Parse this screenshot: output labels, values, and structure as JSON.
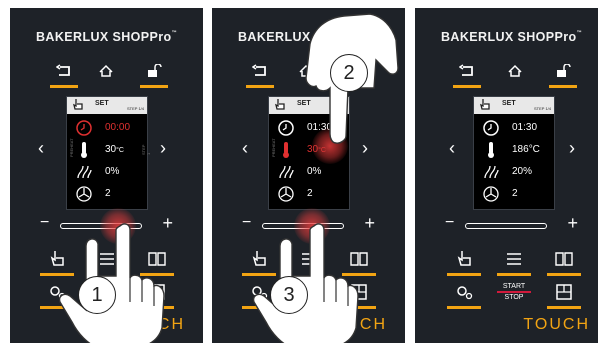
{
  "brand": {
    "name": "BAKERLUX SHOP",
    "script": "Pro",
    "tm": "™"
  },
  "screen": {
    "header_label": "SET",
    "step_label": "STEP 1/4",
    "left_label": "PREHEAT",
    "right_label": "STEP 1"
  },
  "panels": [
    {
      "time": "00:00",
      "temperature": "30",
      "temp_unit": "°C",
      "humidity": "0%",
      "fan": "2",
      "step_number": "1"
    },
    {
      "time": "01:30",
      "temperature": "30",
      "temp_unit": "°C",
      "humidity": "0%",
      "fan": "2",
      "step_number": "3",
      "step_number_top": "2"
    },
    {
      "time": "01:30",
      "temperature": "186",
      "temp_unit": "°C",
      "humidity": "20%",
      "fan": "2",
      "start_label": "START",
      "stop_label": "STOP"
    }
  ],
  "slider": {
    "minus": "−",
    "plus": "+"
  },
  "nav": {
    "prev": "‹",
    "next": "›"
  },
  "footer": {
    "touch": "TOUCH"
  },
  "colors": {
    "accent": "#f2a413",
    "alert": "#d11a3c",
    "panel": "#1e2228"
  }
}
